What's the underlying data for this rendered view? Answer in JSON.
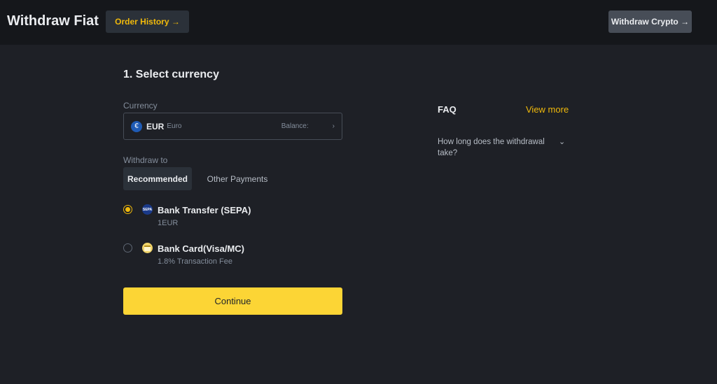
{
  "header": {
    "title": "Withdraw Fiat",
    "order_history": "Order History →",
    "withdraw_crypto": "Withdraw Crypto →"
  },
  "step": {
    "title": "1. Select currency",
    "currency_label": "Currency",
    "currency": {
      "icon": "euro-icon",
      "icon_glyph": "€",
      "code": "EUR",
      "name": "Euro",
      "balance_label": "Balance:",
      "chevron": "›"
    },
    "withdraw_to_label": "Withdraw to",
    "tabs": [
      "Recommended",
      "Other Payments"
    ],
    "methods": [
      {
        "name": "Bank Transfer (SEPA)",
        "sub": "1EUR",
        "icon_text": "SEPA",
        "selected": true
      },
      {
        "name": "Bank Card(Visa/MC)",
        "sub": "1.8% Transaction Fee",
        "icon_text": "",
        "selected": false
      }
    ],
    "continue": "Continue"
  },
  "faq": {
    "title": "FAQ",
    "view_more": "View more",
    "questions": [
      {
        "text": "How long does the withdrawal take?",
        "chevron": "⌄"
      }
    ]
  },
  "colors": {
    "accent": "#f0b90b",
    "button": "#fcd535",
    "background": "#1e2026",
    "topbar": "#15171b"
  }
}
